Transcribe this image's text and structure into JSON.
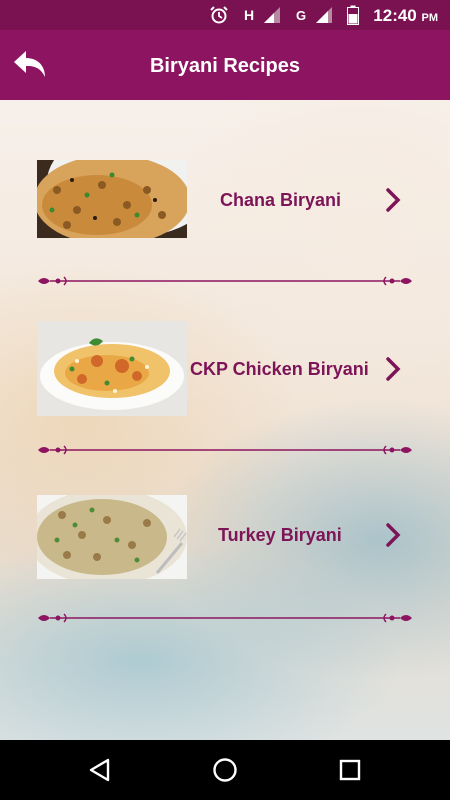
{
  "status_bar": {
    "time": "12:40",
    "meridiem": "PM",
    "network_h": "H",
    "network_g": "G",
    "icons": [
      "alarm-icon",
      "signal-icon",
      "signal-icon",
      "battery-icon"
    ]
  },
  "app_bar": {
    "title": "Biryani Recipes",
    "back_icon": "back-arrow-icon",
    "background": "#8d1460"
  },
  "recipes": [
    {
      "label": "Chana Biryani"
    },
    {
      "label": "CKP Chicken Biryani"
    },
    {
      "label": "Turkey Biryani"
    }
  ],
  "colors": {
    "accent": "#8d1460",
    "status_bar": "#7a1150",
    "label_text": "#7d1457"
  },
  "nav_bar": {
    "buttons": [
      "back-triangle-icon",
      "home-circle-icon",
      "recents-square-icon"
    ]
  }
}
